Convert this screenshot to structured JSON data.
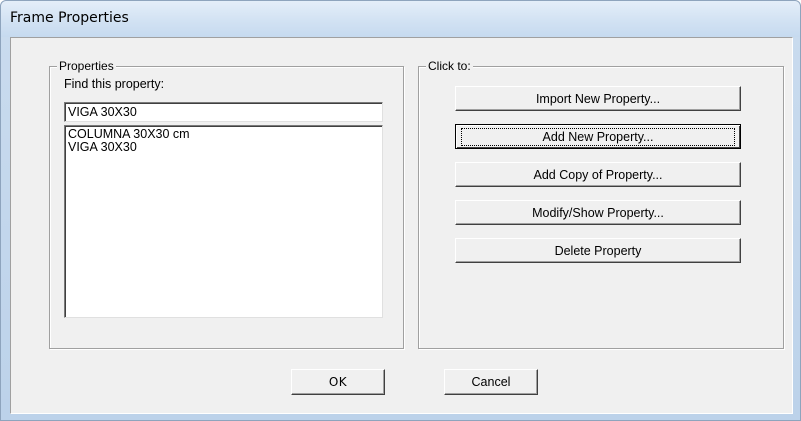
{
  "window": {
    "title": "Frame Properties"
  },
  "properties_group": {
    "legend": "Properties",
    "find_label": "Find this property:",
    "find_value": "VIGA 30X30",
    "items": [
      "COLUMNA 30X30 cm",
      "VIGA 30X30"
    ]
  },
  "click_group": {
    "legend": "Click to:",
    "buttons": {
      "import": "Import New Property...",
      "add_new": "Add New Property...",
      "add_copy": "Add Copy of Property...",
      "modify": "Modify/Show Property...",
      "delete": "Delete Property"
    }
  },
  "footer": {
    "ok": "OK",
    "cancel": "Cancel"
  }
}
